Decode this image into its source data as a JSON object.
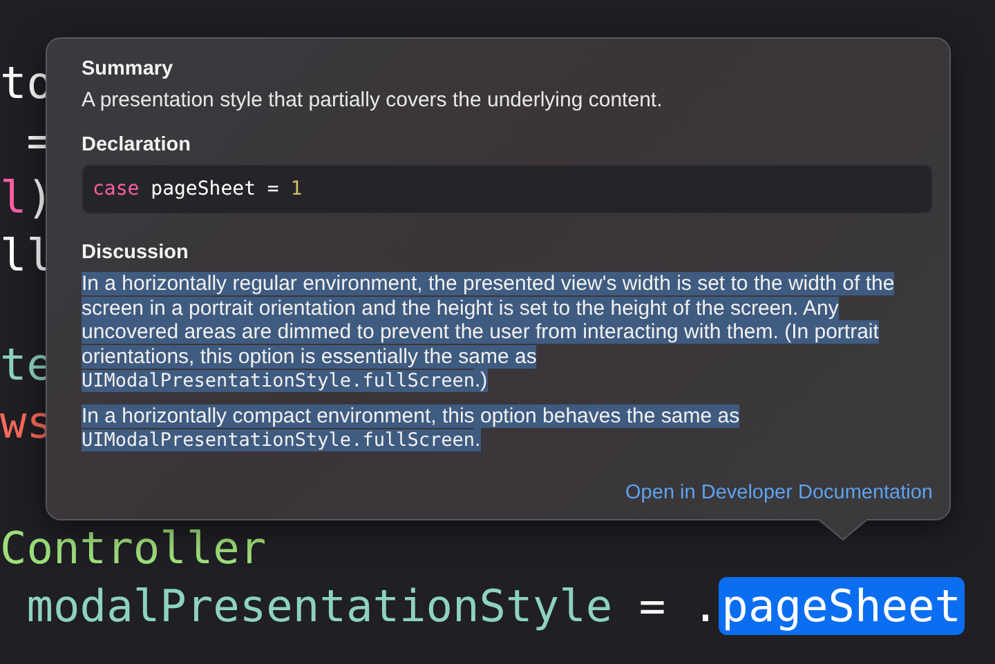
{
  "code_top": [
    {
      "segments": [
        {
          "text": "to",
          "kind": "plain"
        }
      ]
    },
    {
      "segments": [
        {
          "text": " =",
          "kind": "plain"
        }
      ]
    },
    {
      "segments": [
        {
          "text": "l",
          "kind": "keyword"
        },
        {
          "text": ")",
          "kind": "plain"
        }
      ]
    },
    {
      "segments": [
        {
          "text": "ll",
          "kind": "plain"
        }
      ]
    }
  ],
  "code_middle": [
    {
      "segments": [
        {
          "text": "te",
          "kind": "property"
        }
      ]
    },
    {
      "segments": [
        {
          "text": "ws",
          "kind": "call"
        }
      ]
    }
  ],
  "code_bottom": [
    {
      "segments": [
        {
          "text": "Controller",
          "kind": "type"
        }
      ]
    },
    {
      "segments": [
        {
          "text": " modalPresentationStyle",
          "kind": "property"
        },
        {
          "text": " = .",
          "kind": "plain"
        },
        {
          "text": "pageSheet",
          "kind": "selection"
        }
      ]
    }
  ],
  "popover": {
    "summary": {
      "heading": "Summary",
      "text": "A presentation style that partially covers the underlying content."
    },
    "declaration": {
      "heading": "Declaration",
      "code": [
        {
          "text": "case",
          "kind": "keyword"
        },
        {
          "text": " pageSheet = ",
          "kind": "plain"
        },
        {
          "text": "1",
          "kind": "number"
        }
      ]
    },
    "discussion": {
      "heading": "Discussion",
      "selected": true,
      "paragraphs": [
        [
          {
            "text": "In a horizontally regular environment, the presented view's width is set to the width of the screen in a portrait orientation and the height is set to the height of the screen. Any uncovered areas are dimmed to prevent the user from interacting with them. (In portrait orientations, this option is essentially the same as ",
            "kind": "text"
          },
          {
            "text": "UIModalPresentationStyle.fullScreen",
            "kind": "code"
          },
          {
            "text": ".)",
            "kind": "text"
          }
        ],
        [
          {
            "text": "In a horizontally compact environment, this option behaves the same as ",
            "kind": "text"
          },
          {
            "text": "UIModalPresentationStyle.fullScreen",
            "kind": "code"
          },
          {
            "text": ".",
            "kind": "text"
          }
        ]
      ]
    },
    "link": "Open in Developer Documentation"
  }
}
